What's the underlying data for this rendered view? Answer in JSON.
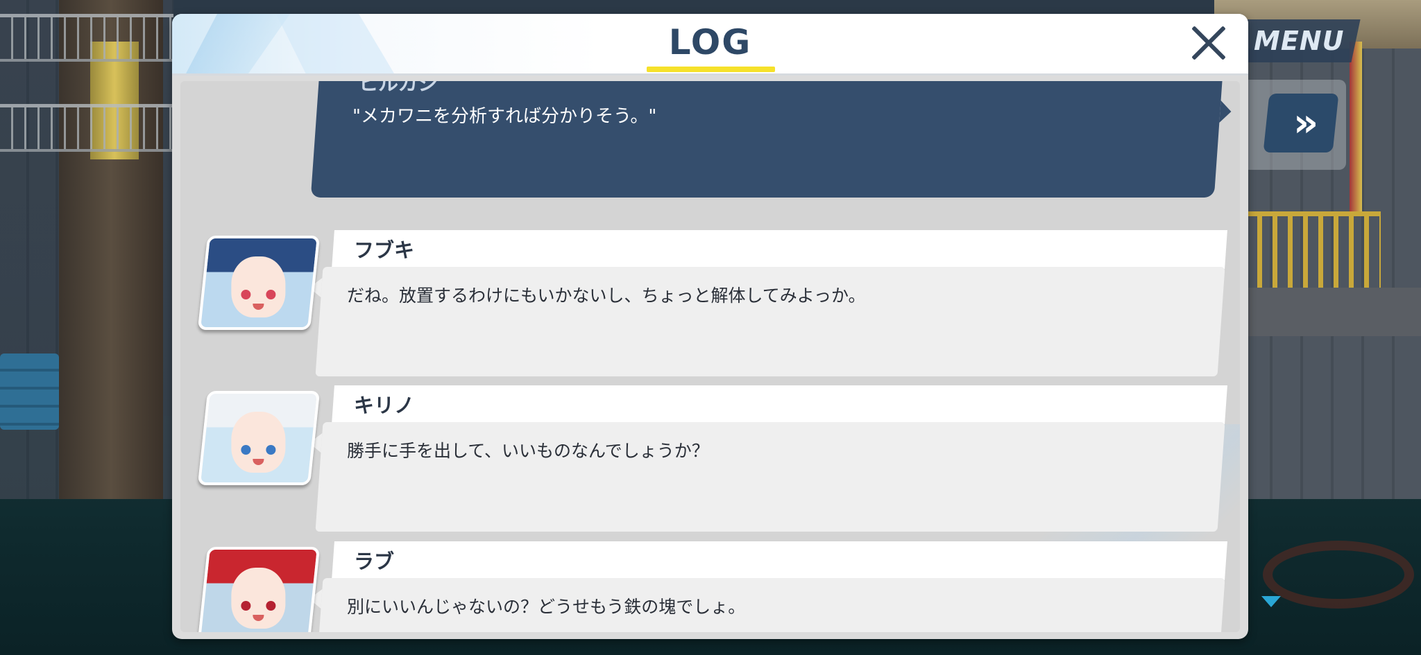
{
  "window": {
    "title": "LOG"
  },
  "controls": {
    "menu_label": "MENU",
    "fast_forward_label": "»"
  },
  "entries": [
    {
      "speaker": "ヒルカシ",
      "text": "\"メカワニを分析すれば分かりそう。\"",
      "selected": true
    },
    {
      "speaker": "フブキ",
      "text": "だね。放置するわけにもいかないし、ちょっと解体してみよっか。",
      "avatar_colors": {
        "hair": "#2b4d84",
        "eyes": "#d8455a",
        "bg": "#bcd9ef"
      }
    },
    {
      "speaker": "キリノ",
      "text": "勝手に手を出して、いいものなんでしょうか？",
      "avatar_colors": {
        "hair": "#eef2f6",
        "eyes": "#3a79c4",
        "bg": "#cfe6f4"
      }
    },
    {
      "speaker": "ラブ",
      "text": "別にいいんじゃないの？どうせもう鉄の塊でしょ。",
      "avatar_colors": {
        "hair": "#c9262f",
        "eyes": "#b52131",
        "bg": "#bfd7e9"
      }
    }
  ]
}
